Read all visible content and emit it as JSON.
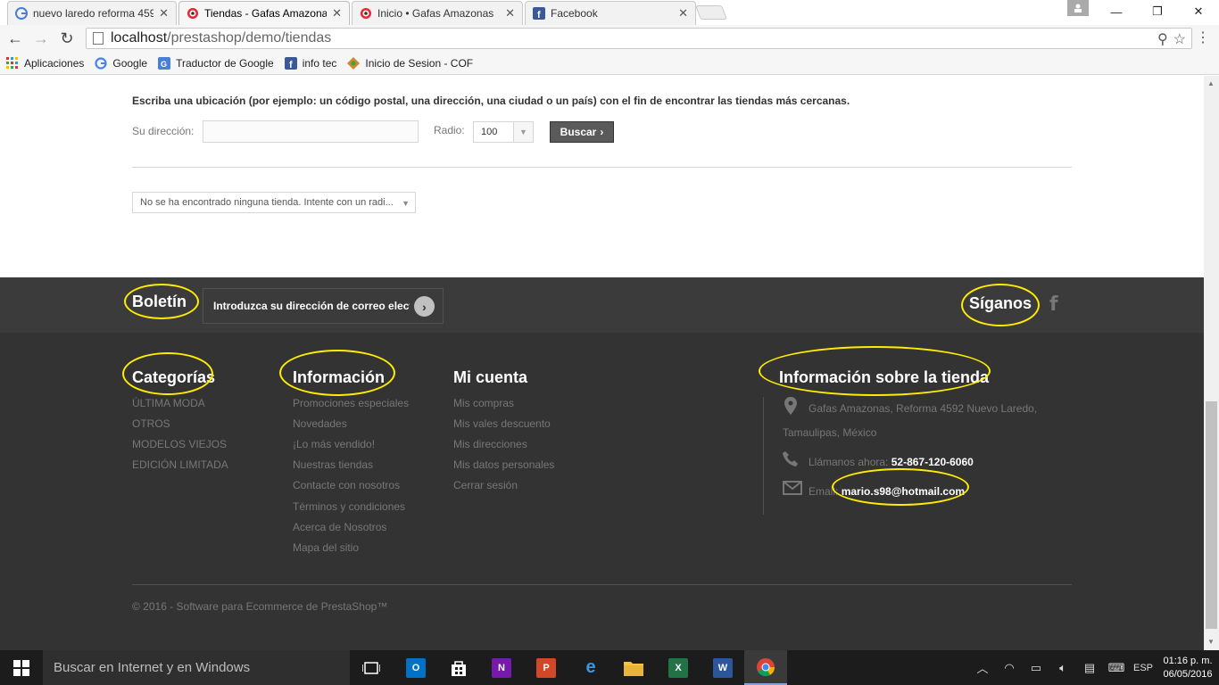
{
  "browser": {
    "tabs": [
      {
        "label": "nuevo laredo reforma 459",
        "favicon": "google-icon"
      },
      {
        "label": "Tiendas - Gafas Amazonas",
        "favicon": "prestashop-icon"
      },
      {
        "label": "Inicio • Gafas Amazonas",
        "favicon": "prestashop-icon"
      },
      {
        "label": "Facebook",
        "favicon": "facebook-icon"
      }
    ],
    "url_host": "localhost",
    "url_path": "/prestashop/demo/tiendas",
    "bookmarks": [
      "Aplicaciones",
      "Google",
      "Traductor de Google",
      "info tec",
      "Inicio de Sesion - COF"
    ]
  },
  "store_search": {
    "instructions": "Escriba una ubicación (por ejemplo: un código postal, una dirección, una ciudad o un país) con el fin de encontrar las tiendas más cercanas.",
    "address_label": "Su dirección:",
    "address_value": "",
    "radius_label": "Radio:",
    "radius_value": "100",
    "search_button": "Buscar",
    "results_text": "No se ha encontrado ninguna tienda. Intente con un radi..."
  },
  "footer": {
    "newsletter_title": "Boletín",
    "newsletter_placeholder": "Introduzca su dirección de correo electrónico",
    "follow_title": "Síganos",
    "categories": {
      "title": "Categorías",
      "items": [
        "ÚLTIMA MODA",
        "OTROS",
        "MODELOS VIEJOS",
        "EDICIÓN LIMITADA"
      ]
    },
    "information": {
      "title": "Información",
      "items": [
        "Promociones especiales",
        "Novedades",
        "¡Lo más vendido!",
        "Nuestras tiendas",
        "Contacte con nosotros",
        "Términos y condiciones",
        "Acerca de Nosotros",
        "Mapa del sitio"
      ]
    },
    "account": {
      "title": "Mi cuenta",
      "items": [
        "Mis compras",
        "Mis vales descuento",
        "Mis direcciones",
        "Mis datos personales",
        "Cerrar sesión"
      ]
    },
    "store_info": {
      "title": "Información sobre la tienda",
      "address_line1": "Gafas Amazonas, Reforma 4592 Nuevo Laredo,",
      "address_line2": "Tamaulipas, México",
      "phone_label": "Llámanos ahora:",
      "phone": "52-867-120-6060",
      "email_label": "Email:",
      "email": "mario.s98@hotmail.com"
    },
    "copyright": "© 2016 - Software para Ecommerce de PrestaShop™"
  },
  "taskbar": {
    "search_placeholder": "Buscar en Internet y en Windows",
    "language": "ESP",
    "time": "01:16 p. m.",
    "date": "06/05/2016"
  },
  "colors": {
    "footer_bg": "#333333",
    "newsletter_bg": "#3b3b3b",
    "annotation": "#ffec00",
    "search_button": "#5a5a5a"
  }
}
